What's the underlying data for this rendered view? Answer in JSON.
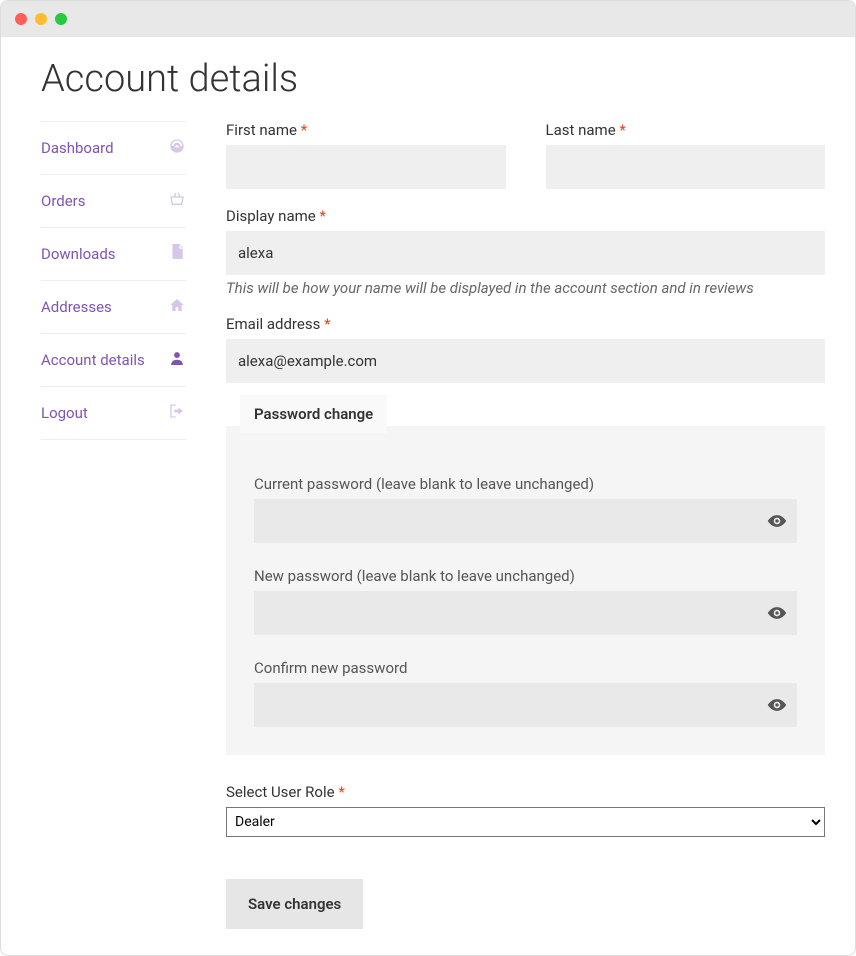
{
  "page": {
    "title": "Account details"
  },
  "sidebar": {
    "items": [
      {
        "label": "Dashboard",
        "icon": "dashboard"
      },
      {
        "label": "Orders",
        "icon": "basket"
      },
      {
        "label": "Downloads",
        "icon": "file"
      },
      {
        "label": "Addresses",
        "icon": "home"
      },
      {
        "label": "Account details",
        "icon": "user",
        "active": true
      },
      {
        "label": "Logout",
        "icon": "signout"
      }
    ]
  },
  "form": {
    "first_name": {
      "label": "First name",
      "value": ""
    },
    "last_name": {
      "label": "Last name",
      "value": ""
    },
    "display_name": {
      "label": "Display name",
      "value": "alexa",
      "hint": "This will be how your name will be displayed in the account section and in reviews"
    },
    "email": {
      "label": "Email address",
      "value": "alexa@example.com"
    },
    "password_section": {
      "legend": "Password change",
      "current": {
        "label": "Current password (leave blank to leave unchanged)",
        "value": ""
      },
      "new": {
        "label": "New password (leave blank to leave unchanged)",
        "value": ""
      },
      "confirm": {
        "label": "Confirm new password",
        "value": ""
      }
    },
    "user_role": {
      "label": "Select User Role",
      "selected": "Dealer"
    },
    "save_label": "Save changes"
  }
}
